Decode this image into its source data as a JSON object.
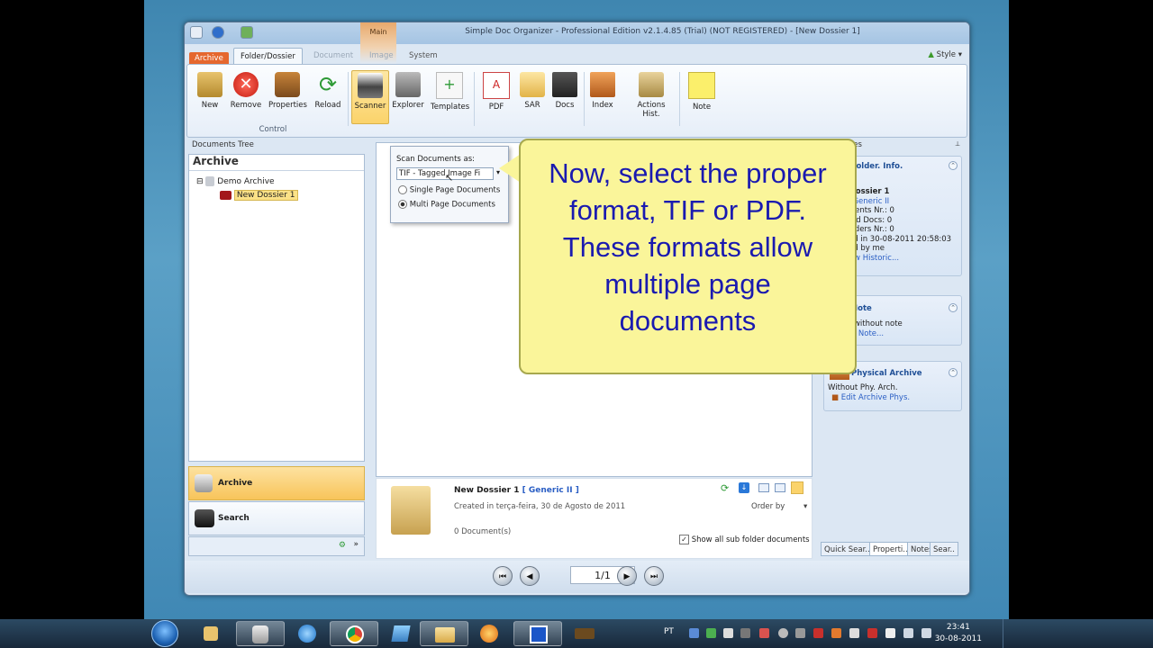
{
  "window": {
    "title": "Simple Doc Organizer - Professional Edition v2.1.4.85 (Trial) (NOT REGISTERED) - [New Dossier 1]",
    "context_tab": "Main"
  },
  "tabs": {
    "archive": "Archive",
    "folder": "Folder/Dossier",
    "document": "Document",
    "image": "Image",
    "system": "System",
    "style": "Style"
  },
  "ribbon": {
    "new": "New",
    "remove": "Remove",
    "properties": "Properties",
    "reload": "Reload",
    "scanner": "Scanner",
    "explorer": "Explorer",
    "templates": "Templates",
    "pdf": "PDF",
    "sar": "SAR",
    "docs": "Docs",
    "index": "Index",
    "actions_hist": "Actions Hist.",
    "note": "Note",
    "group_control": "Control"
  },
  "left_panel": {
    "title": "Documents Tree",
    "archive_header": "Archive",
    "tree_root": "Demo Archive",
    "tree_child": "New Dossier 1",
    "nav_archive": "Archive",
    "nav_search": "Search"
  },
  "dropdown": {
    "label": "Scan Documents as:",
    "selected": "TIF - Tagged Image Fi",
    "option_single": "Single Page Documents",
    "option_multi": "Multi Page Documents"
  },
  "callout": {
    "text": "Now, select the proper format, TIF or PDF. These formats allow multiple page documents"
  },
  "center": {
    "dossier_name": "New Dossier 1",
    "mask": "[ Generic II ]",
    "created": "Created in terça-feira, 30 de Agosto de 2011",
    "doc_count": "0 Document(s)",
    "order_by": "Order by",
    "show_sub": "Show all sub folder documents"
  },
  "right_panel": {
    "title": "Properties",
    "folder_info": {
      "title": "Folder. Info.",
      "name": "New Dossier 1",
      "mask": "Mask: Generic II",
      "docs_nr": "Documents Nr.:  0",
      "scanned": "Scanned Docs:  0",
      "subfolders": "Sub-folders Nr.:  0",
      "created": "Created in 30-08-2011 20:58:03",
      "created_by": "Created by me",
      "link": "View Historic..."
    },
    "note": {
      "title": "Note",
      "body": "Folder without note",
      "link": "Add Note..."
    },
    "physical": {
      "title": "Physical Archive",
      "body": "Without Phy. Arch.",
      "link": "Edit Archive Phys."
    },
    "tabs": [
      "Quick Sear..",
      "Properti..",
      "Notes",
      "Sear.."
    ]
  },
  "pager": {
    "page": "1/1"
  },
  "taskbar": {
    "lang": "PT",
    "time": "23:41",
    "date": "30-08-2011"
  },
  "colors": {
    "accent_orange": "#e5672e",
    "callout_fill": "#faf59a",
    "callout_text": "#1a1ab0",
    "link": "#2a5ec4"
  }
}
